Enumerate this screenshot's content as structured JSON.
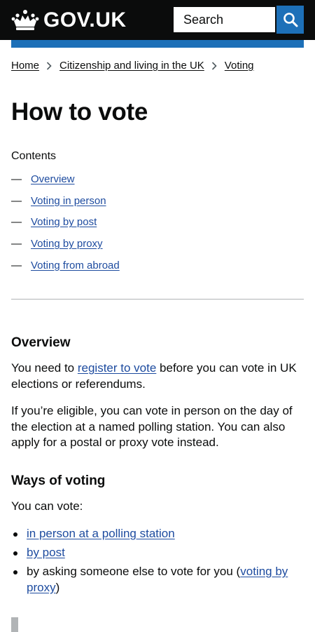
{
  "header": {
    "logo_text": "GOV.UK",
    "search_placeholder": "Search"
  },
  "colors": {
    "header_bg": "#0b0c0c",
    "brand_blue": "#1d70b8",
    "link": "#1d4b9f",
    "text": "#0b0c0c",
    "divider": "#b1b4b6"
  },
  "breadcrumbs": [
    "Home",
    "Citizenship and living in the UK",
    "Voting"
  ],
  "page_title": "How to vote",
  "contents": {
    "label": "Contents",
    "dash": "—",
    "items": [
      "Overview",
      "Voting in person",
      "Voting by post",
      "Voting by proxy",
      "Voting from abroad"
    ]
  },
  "overview": {
    "heading": "Overview",
    "p1_before": "You need to ",
    "p1_link": "register to vote",
    "p1_after": " before you can vote in UK elections or referendums.",
    "p2": "If you’re eligible, you can vote in person on the day of the election at a named polling station. You can also apply for a postal or proxy vote instead."
  },
  "ways": {
    "heading": "Ways of voting",
    "intro": "You can vote:",
    "item1_link": "in person at a polling station",
    "item2_link": "by post",
    "item3_before": "by asking someone else to vote for you (",
    "item3_link": "voting by proxy",
    "item3_after": ")"
  },
  "icons": {
    "logo": "crown-icon",
    "search": "search-icon",
    "breadcrumb_separator": "chevron-right-icon"
  }
}
